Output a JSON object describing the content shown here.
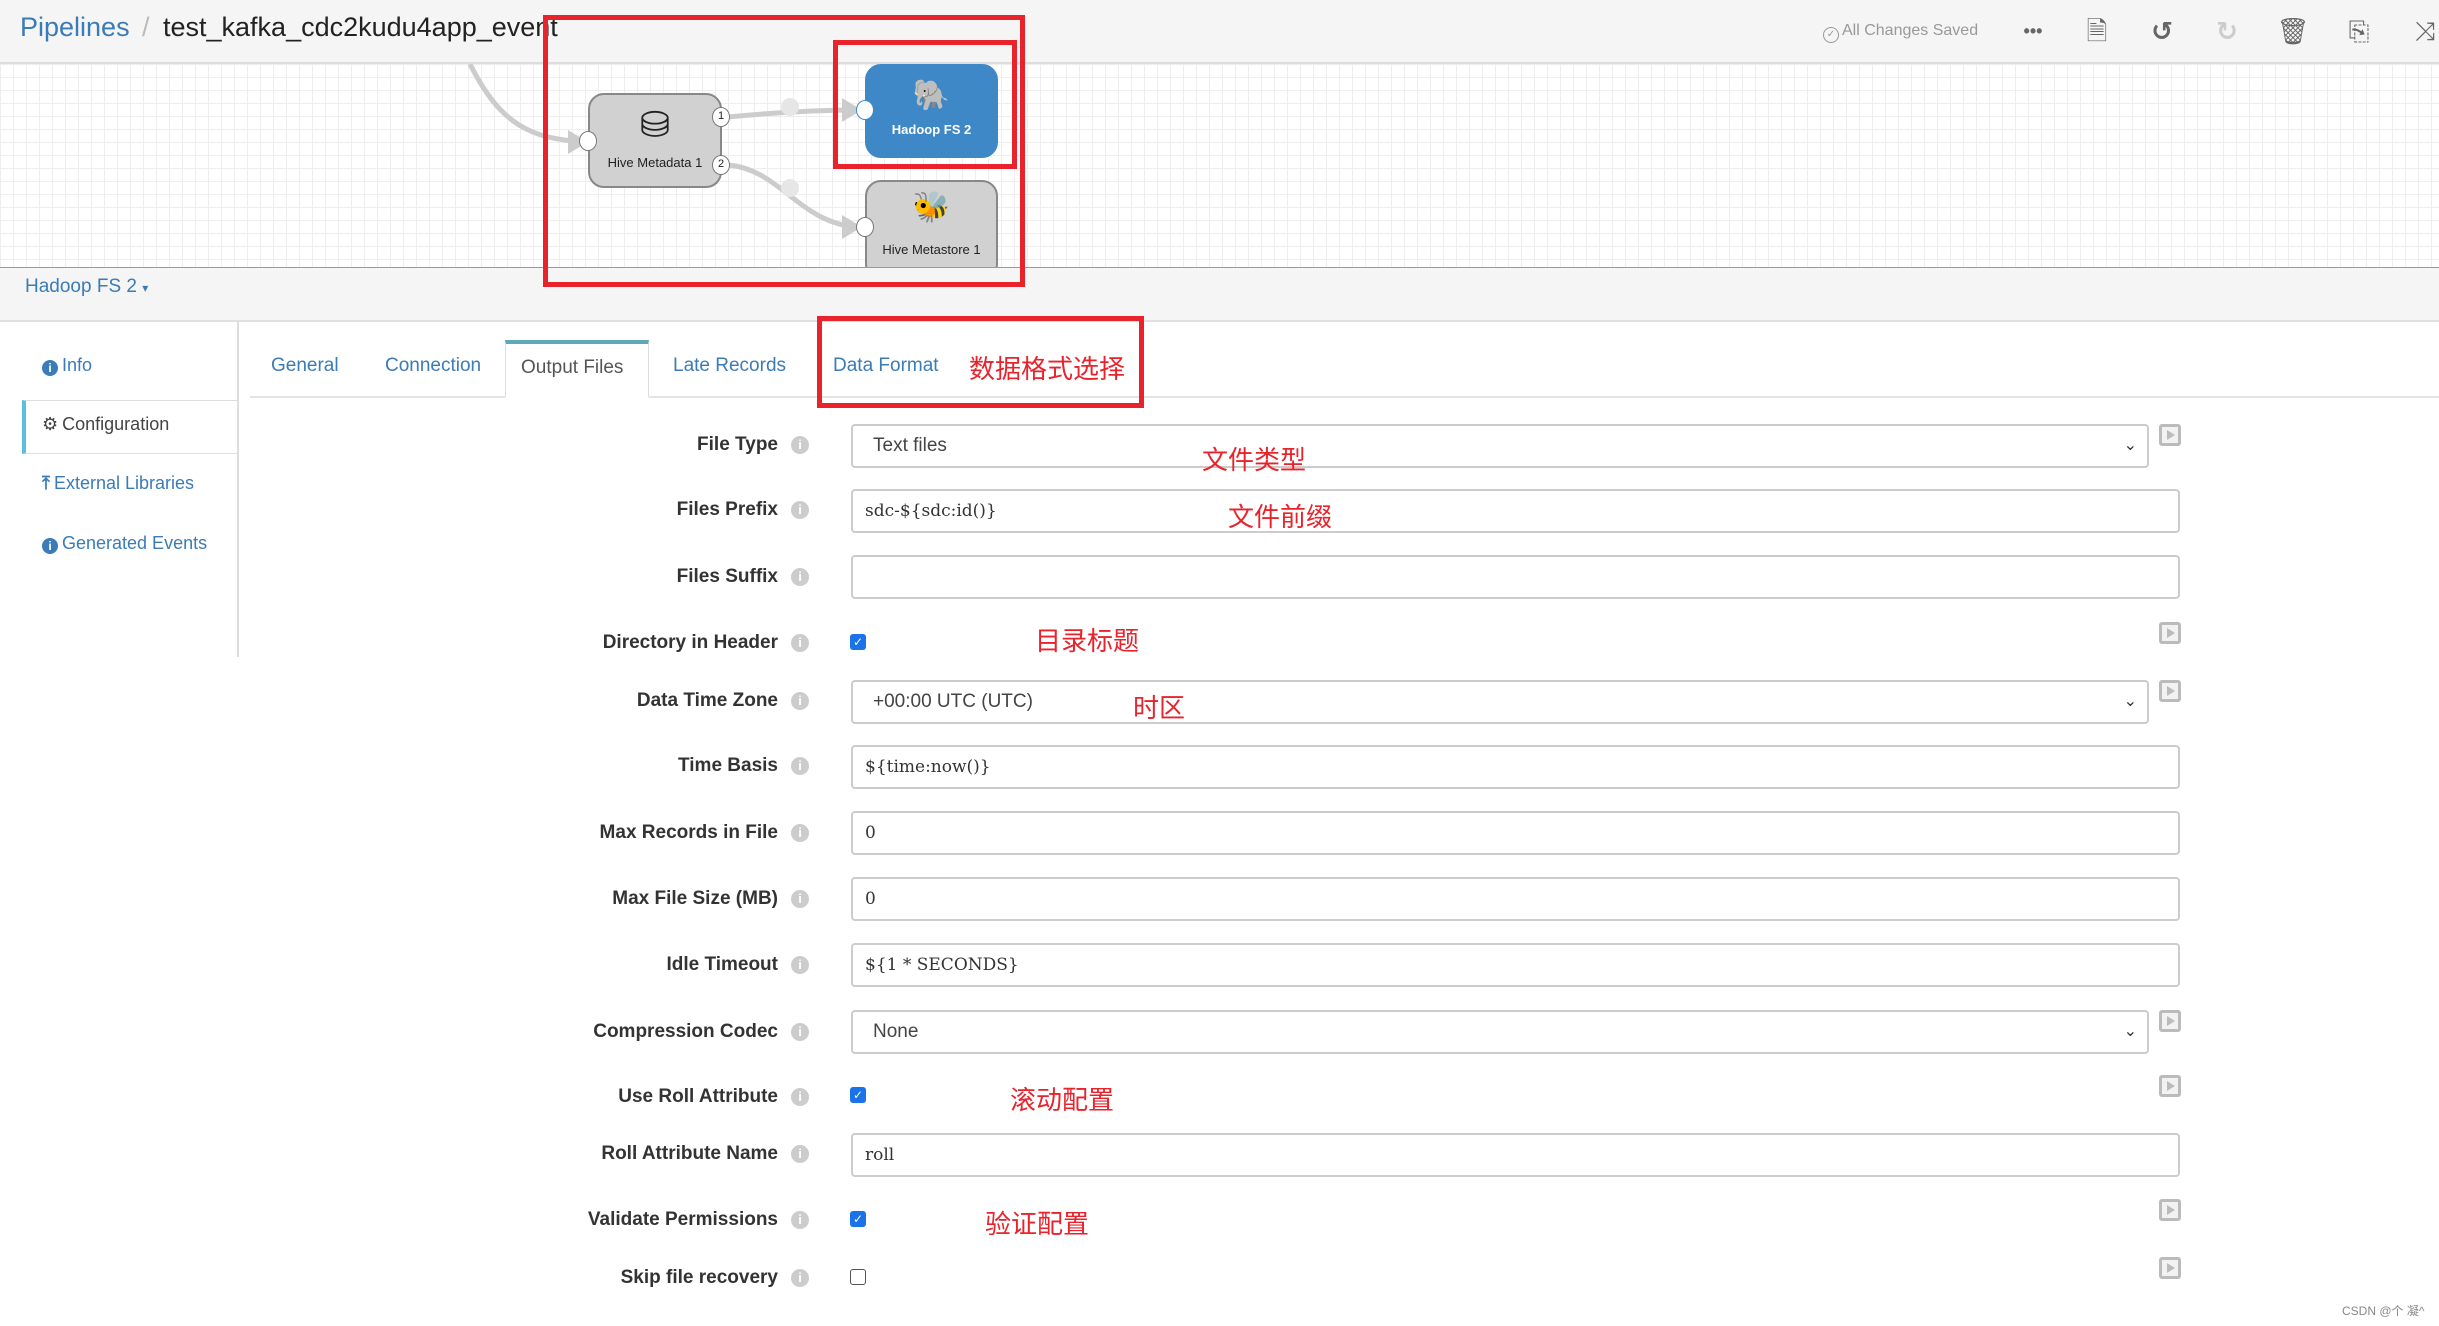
{
  "header": {
    "breadcrumb_root": "Pipelines",
    "breadcrumb_sep": "/",
    "pipeline_title": "test_kafka_cdc2kudu4app_event",
    "save_status": "All Changes Saved",
    "toolbar": [
      {
        "name": "more-icon",
        "glyph": "•••"
      },
      {
        "name": "document-icon",
        "glyph": "🗎"
      },
      {
        "name": "undo-icon",
        "glyph": "↺"
      },
      {
        "name": "redo-icon",
        "glyph": "↻"
      },
      {
        "name": "trash-icon",
        "glyph": "🗑"
      },
      {
        "name": "copy-icon",
        "glyph": "⎘"
      },
      {
        "name": "shuffle-icon",
        "glyph": "⤨"
      }
    ]
  },
  "canvas": {
    "nodes": [
      {
        "label": "Hive Metadata 1",
        "icon": "database-gear-icon",
        "ports": [
          "1",
          "2"
        ]
      },
      {
        "label": "Hadoop FS 2",
        "icon": "hadoop-elephant-icon",
        "selected": true
      },
      {
        "label": "Hive Metastore 1",
        "icon": "hive-icon"
      }
    ]
  },
  "node_bar": {
    "title": "Hadoop FS 2"
  },
  "sidebar": {
    "items": [
      {
        "label": "Info",
        "icon": "info-icon"
      },
      {
        "label": "Configuration",
        "icon": "gear-icon",
        "active": true
      },
      {
        "label": "External Libraries",
        "icon": "upload-icon"
      },
      {
        "label": "Generated Events",
        "icon": "info-icon"
      }
    ]
  },
  "tabs": [
    {
      "label": "General"
    },
    {
      "label": "Connection"
    },
    {
      "label": "Output Files",
      "active": true
    },
    {
      "label": "Late Records"
    },
    {
      "label": "Data Format"
    }
  ],
  "form": {
    "file_type": {
      "label": "File Type",
      "value": "Text files"
    },
    "files_prefix": {
      "label": "Files Prefix",
      "value": "sdc-${sdc:id()}"
    },
    "files_suffix": {
      "label": "Files Suffix",
      "value": ""
    },
    "directory_in_header": {
      "label": "Directory in Header",
      "checked": true
    },
    "data_time_zone": {
      "label": "Data Time Zone",
      "value": "+00:00 UTC (UTC)"
    },
    "time_basis": {
      "label": "Time Basis",
      "value": "${time:now()}"
    },
    "max_records": {
      "label": "Max Records in File",
      "value": "0"
    },
    "max_file_size": {
      "label": "Max File Size (MB)",
      "value": "0"
    },
    "idle_timeout": {
      "label": "Idle Timeout",
      "value": "${1 * SECONDS}"
    },
    "compression_codec": {
      "label": "Compression Codec",
      "value": "None"
    },
    "use_roll_attribute": {
      "label": "Use Roll Attribute",
      "checked": true
    },
    "roll_attribute_name": {
      "label": "Roll Attribute Name",
      "value": "roll"
    },
    "validate_permissions": {
      "label": "Validate Permissions",
      "checked": true
    },
    "skip_file_recovery": {
      "label": "Skip file recovery",
      "checked": false
    }
  },
  "annotations": {
    "data_format": "数据格式选择",
    "file_type": "文件类型",
    "files_prefix": "文件前缀",
    "directory_header": "目录标题",
    "time_zone": "时区",
    "roll": "滚动配置",
    "validate": "验证配置"
  },
  "colors": {
    "accent": "#3a7bb8",
    "selected_node": "#3f88c7",
    "annotation_red": "#e8232c",
    "checkbox": "#1a73e8"
  },
  "watermark": "CSDN @个 凝^"
}
